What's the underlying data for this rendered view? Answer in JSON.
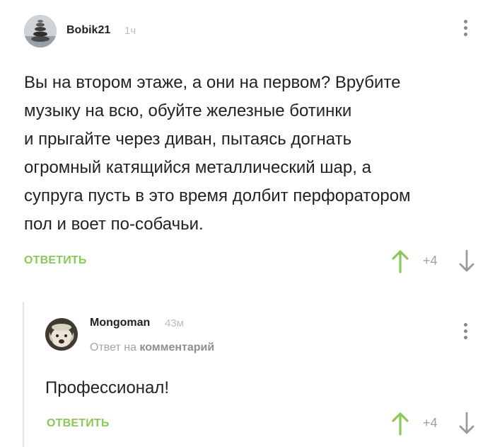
{
  "comments": [
    {
      "username": "Bobik21",
      "time": "1ч",
      "text_lines": [
        "Вы на втором этаже, а они на первом? Врубите",
        "музыку на всю, обуйте железные ботинки",
        "и прыгайте через диван, пытаясь догнать",
        "огромный катящийся металлический шар, а",
        "супруга пусть в это время долбит перфоратором",
        "пол и воет по-собачьи."
      ],
      "reply_label": "ОТВЕТИТЬ",
      "rating": "+4",
      "avatar_icon": "stone-stack-avatar",
      "menu_icon": "more-vertical-icon"
    },
    {
      "username": "Mongoman",
      "time": "43м",
      "reply_to_prefix": "Ответ на",
      "reply_to_link": "комментарий",
      "text_lines": [
        "Профессионал!"
      ],
      "reply_label": "ОТВЕТИТЬ",
      "rating": "+4",
      "avatar_icon": "dog-avatar",
      "menu_icon": "more-vertical-icon"
    }
  ],
  "colors": {
    "accent_green": "#8ac858",
    "vote_down_gray": "#9a9a9a",
    "muted_text": "#a6a6a6"
  }
}
